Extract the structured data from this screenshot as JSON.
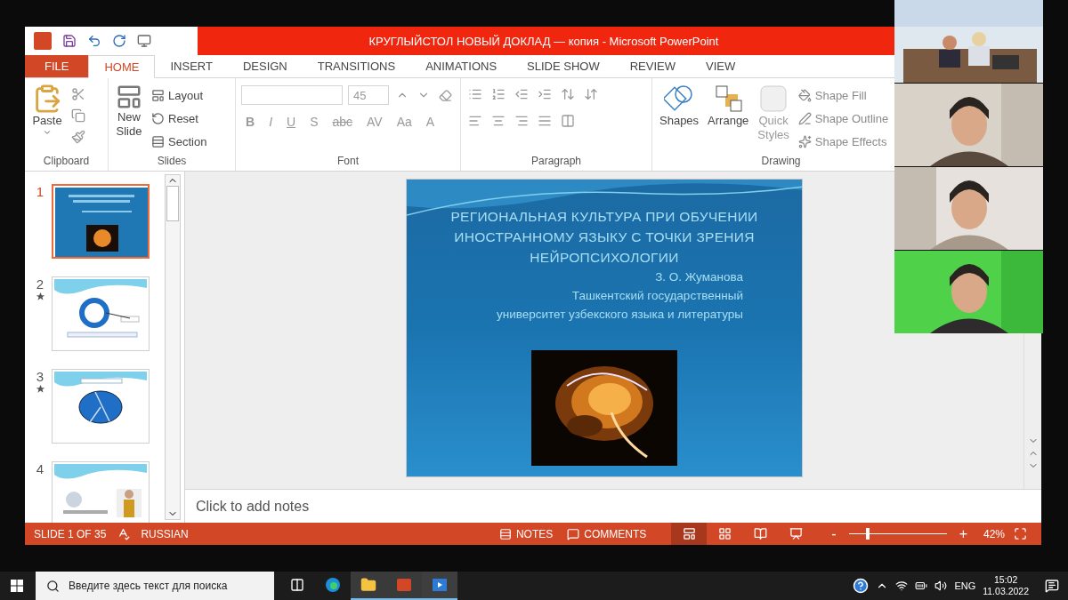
{
  "window": {
    "title": "КРУГЛЫЙСТОЛ НОВЫЙ ДОКЛАД — копия -  Microsoft PowerPoint"
  },
  "tabs": [
    {
      "label": "FILE",
      "kind": "file",
      "selected": false
    },
    {
      "label": "HOME",
      "kind": "tab",
      "selected": true
    },
    {
      "label": "INSERT",
      "kind": "tab",
      "selected": false
    },
    {
      "label": "DESIGN",
      "kind": "tab",
      "selected": false
    },
    {
      "label": "TRANSITIONS",
      "kind": "tab",
      "selected": false
    },
    {
      "label": "ANIMATIONS",
      "kind": "tab",
      "selected": false
    },
    {
      "label": "SLIDE SHOW",
      "kind": "tab",
      "selected": false
    },
    {
      "label": "REVIEW",
      "kind": "tab",
      "selected": false
    },
    {
      "label": "VIEW",
      "kind": "tab",
      "selected": false
    }
  ],
  "ribbon": {
    "clipboard": {
      "label": "Clipboard",
      "paste": "Paste"
    },
    "slides": {
      "label": "Slides",
      "new_slide": "New\nSlide",
      "items": [
        "Layout",
        "Reset",
        "Section"
      ]
    },
    "font": {
      "label": "Font",
      "font_size": "45",
      "buttons": [
        "B",
        "I",
        "U",
        "S",
        "abc",
        "AV",
        "Aa",
        "A"
      ]
    },
    "paragraph": {
      "label": "Paragraph"
    },
    "drawing": {
      "label": "Drawing",
      "shapes": "Shapes",
      "arrange": "Arrange",
      "quick_styles": "Quick\nStyles",
      "items": [
        "Shape Fill",
        "Shape Outline",
        "Shape Effects"
      ]
    }
  },
  "slides": [
    {
      "number": "1",
      "kind": "title",
      "selected": true,
      "animated": false
    },
    {
      "number": "2",
      "kind": "cycle",
      "selected": false,
      "animated": true
    },
    {
      "number": "3",
      "kind": "pie",
      "selected": false,
      "animated": true
    },
    {
      "number": "4",
      "selected": false,
      "animated": false
    }
  ],
  "slide": {
    "title": "РЕГИОНАЛЬНАЯ КУЛЬТУРА ПРИ ОБУЧЕНИИ\nИНОСТРАННОМУ ЯЗЫКУ С ТОЧКИ ЗРЕНИЯ\nНЕЙРОПСИХОЛОГИИ",
    "subtitle": "З. О. Жуманова\nТашкентский государственный\nуниверситет узбекского языка и литературы"
  },
  "notes": {
    "placeholder": "Click to add notes"
  },
  "status_bar": {
    "slide_counter": "SLIDE 1 OF 35",
    "language": "RUSSIAN",
    "notes": "NOTES",
    "comments": "COMMENTS",
    "views": [
      {
        "kind": "normal",
        "selected": true
      },
      {
        "kind": "sorter",
        "selected": false
      },
      {
        "kind": "reading",
        "selected": false
      },
      {
        "kind": "slideshow",
        "selected": false
      }
    ],
    "zoom": {
      "minus": "-",
      "plus": "+",
      "level": 0.19,
      "reading": "42%"
    }
  },
  "taskbar": {
    "search": {
      "placeholder": "Введите здесь текст для поиска"
    },
    "language": "ENG",
    "time": "15:02",
    "date": "11.03.2022"
  }
}
